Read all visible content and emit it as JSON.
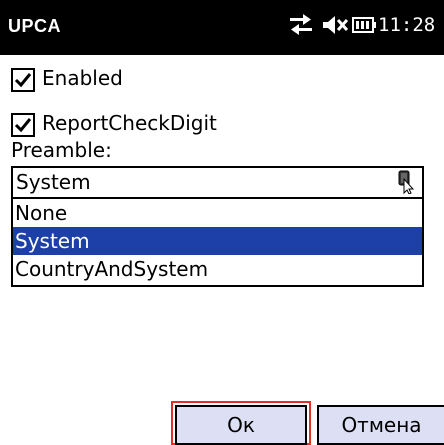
{
  "window": {
    "title": "UPCA",
    "clock": "11:28"
  },
  "status_icons": [
    "connectivity-icon",
    "speaker-muted-icon",
    "battery-icon"
  ],
  "options": {
    "enabled_label": "Enabled",
    "enabled_checked": true,
    "report_check_digit_label": "ReportCheckDigit",
    "report_check_digit_checked": true
  },
  "preamble": {
    "label": "Preamble:",
    "selected_value": "System",
    "items": [
      "None",
      "System",
      "CountryAndSystem"
    ]
  },
  "buttons": {
    "ok_label": "Ок",
    "cancel_label": "Отмена"
  },
  "colors": {
    "titlebar": "#000000",
    "selection": "#1d3fa8",
    "button_face": "#dde0f4",
    "focus_outline": "#e0302e"
  }
}
